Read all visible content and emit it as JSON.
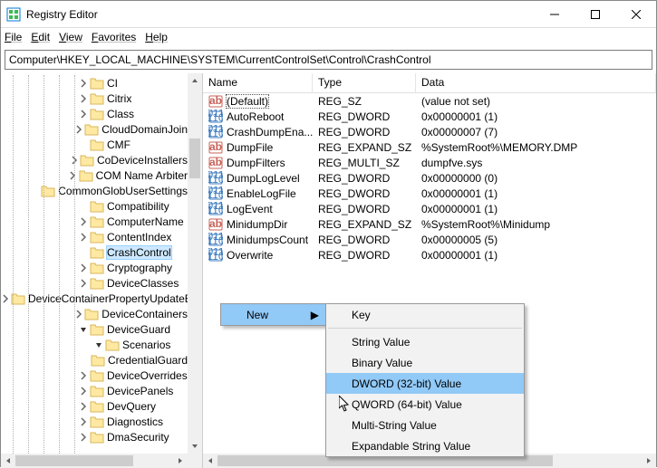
{
  "window": {
    "title": "Registry Editor"
  },
  "menubar": {
    "items": [
      "File",
      "Edit",
      "View",
      "Favorites",
      "Help"
    ]
  },
  "addressbar": {
    "path": "Computer\\HKEY_LOCAL_MACHINE\\SYSTEM\\CurrentControlSet\\Control\\CrashControl"
  },
  "tree": {
    "items": [
      {
        "indent": 5,
        "expand": "right",
        "label": "CI"
      },
      {
        "indent": 5,
        "expand": "right",
        "label": "Citrix"
      },
      {
        "indent": 5,
        "expand": "right",
        "label": "Class"
      },
      {
        "indent": 5,
        "expand": "right",
        "label": "CloudDomainJoin"
      },
      {
        "indent": 5,
        "expand": "none",
        "label": "CMF"
      },
      {
        "indent": 5,
        "expand": "right",
        "label": "CoDeviceInstallers"
      },
      {
        "indent": 5,
        "expand": "right",
        "label": "COM Name Arbiter"
      },
      {
        "indent": 5,
        "expand": "none",
        "label": "CommonGlobUserSettings"
      },
      {
        "indent": 5,
        "expand": "none",
        "label": "Compatibility"
      },
      {
        "indent": 5,
        "expand": "right",
        "label": "ComputerName"
      },
      {
        "indent": 5,
        "expand": "right",
        "label": "ContentIndex"
      },
      {
        "indent": 5,
        "expand": "none",
        "label": "CrashControl",
        "selected": true
      },
      {
        "indent": 5,
        "expand": "right",
        "label": "Cryptography"
      },
      {
        "indent": 5,
        "expand": "right",
        "label": "DeviceClasses"
      },
      {
        "indent": 5,
        "expand": "right",
        "label": "DeviceContainerPropertyUpdateEvents"
      },
      {
        "indent": 5,
        "expand": "right",
        "label": "DeviceContainers"
      },
      {
        "indent": 5,
        "expand": "down",
        "label": "DeviceGuard"
      },
      {
        "indent": 6,
        "expand": "down",
        "label": "Scenarios"
      },
      {
        "indent": 7,
        "expand": "none",
        "label": "CredentialGuard"
      },
      {
        "indent": 5,
        "expand": "right",
        "label": "DeviceOverrides"
      },
      {
        "indent": 5,
        "expand": "right",
        "label": "DevicePanels"
      },
      {
        "indent": 5,
        "expand": "right",
        "label": "DevQuery"
      },
      {
        "indent": 5,
        "expand": "right",
        "label": "Diagnostics"
      },
      {
        "indent": 5,
        "expand": "right",
        "label": "DmaSecurity"
      }
    ]
  },
  "list": {
    "columns": {
      "name": "Name",
      "type": "Type",
      "data": "Data"
    },
    "rows": [
      {
        "icon": "sz",
        "name": "(Default)",
        "type": "REG_SZ",
        "data": "(value not set)",
        "selected": true
      },
      {
        "icon": "bin",
        "name": "AutoReboot",
        "type": "REG_DWORD",
        "data": "0x00000001 (1)"
      },
      {
        "icon": "bin",
        "name": "CrashDumpEna...",
        "type": "REG_DWORD",
        "data": "0x00000007 (7)"
      },
      {
        "icon": "sz",
        "name": "DumpFile",
        "type": "REG_EXPAND_SZ",
        "data": "%SystemRoot%\\MEMORY.DMP"
      },
      {
        "icon": "sz",
        "name": "DumpFilters",
        "type": "REG_MULTI_SZ",
        "data": "dumpfve.sys"
      },
      {
        "icon": "bin",
        "name": "DumpLogLevel",
        "type": "REG_DWORD",
        "data": "0x00000000 (0)"
      },
      {
        "icon": "bin",
        "name": "EnableLogFile",
        "type": "REG_DWORD",
        "data": "0x00000001 (1)"
      },
      {
        "icon": "bin",
        "name": "LogEvent",
        "type": "REG_DWORD",
        "data": "0x00000001 (1)"
      },
      {
        "icon": "sz",
        "name": "MinidumpDir",
        "type": "REG_EXPAND_SZ",
        "data": "%SystemRoot%\\Minidump"
      },
      {
        "icon": "bin",
        "name": "MinidumpsCount",
        "type": "REG_DWORD",
        "data": "0x00000005 (5)"
      },
      {
        "icon": "bin",
        "name": "Overwrite",
        "type": "REG_DWORD",
        "data": "0x00000001 (1)"
      }
    ]
  },
  "context_menu": {
    "primary": [
      {
        "label": "New",
        "highlight": true,
        "submenu": true
      }
    ],
    "submenu": [
      {
        "label": "Key"
      },
      {
        "sep": true
      },
      {
        "label": "String Value"
      },
      {
        "label": "Binary Value"
      },
      {
        "label": "DWORD (32-bit) Value",
        "highlight": true
      },
      {
        "label": "QWORD (64-bit) Value"
      },
      {
        "label": "Multi-String Value"
      },
      {
        "label": "Expandable String Value"
      }
    ]
  }
}
